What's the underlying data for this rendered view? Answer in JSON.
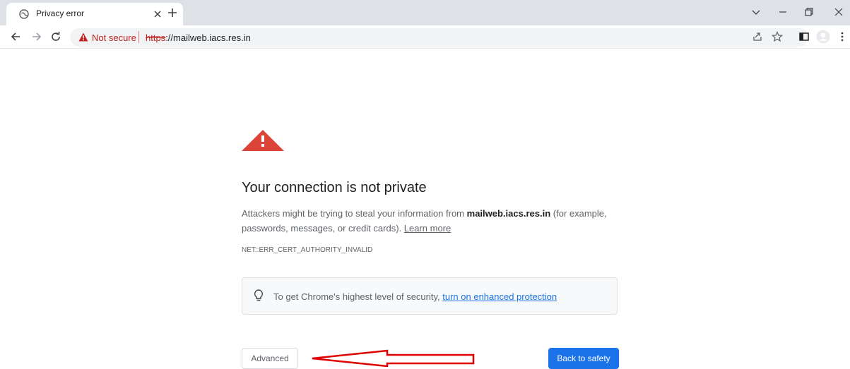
{
  "tab": {
    "title": "Privacy error",
    "favicon": "globe-icon",
    "close_icon": "close-icon"
  },
  "new_tab_icon": "plus-icon",
  "window_controls": [
    "chevron-down-icon",
    "minimize-icon",
    "restore-icon",
    "close-icon"
  ],
  "toolbar": {
    "nav_icons": [
      "back-arrow-icon",
      "forward-arrow-icon",
      "reload-icon"
    ],
    "security_label": "Not secure",
    "url_scheme": "https",
    "url_rest": "://mailweb.iacs.res.in",
    "right_icons": [
      "share-icon",
      "star-icon",
      "side-panel-icon",
      "profile-avatar-icon",
      "kebab-menu-icon"
    ]
  },
  "interstitial": {
    "heading": "Your connection is not private",
    "para_pre": "Attackers might be trying to steal your information from ",
    "host": "mailweb.iacs.res.in",
    "para_post": " (for example, passwords, messages, or credit cards). ",
    "learn_more": "Learn more",
    "error_code": "NET::ERR_CERT_AUTHORITY_INVALID",
    "tip_pre": "To get Chrome's highest level of security, ",
    "tip_link": "turn on enhanced protection",
    "advanced_button": "Advanced",
    "back_button": "Back to safety"
  },
  "colors": {
    "warning_red": "#db4437",
    "link_blue": "#1a73e8",
    "annotation_arrow": "#e00000"
  }
}
